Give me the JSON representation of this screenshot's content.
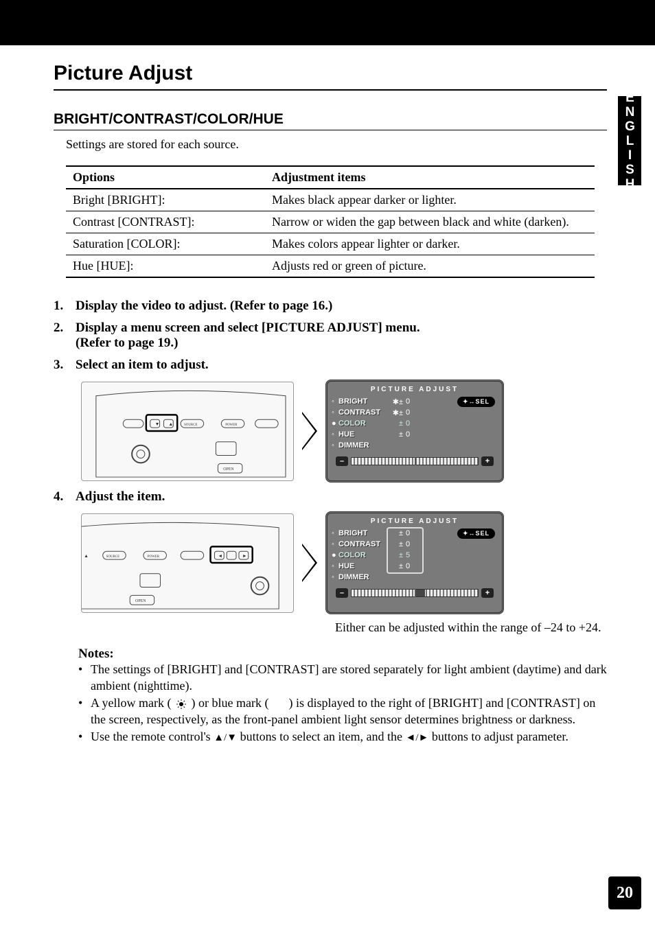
{
  "side_tab": "ENGLISH",
  "page_number": "20",
  "main_title": "Picture Adjust",
  "sub_title": "BRIGHT/CONTRAST/COLOR/HUE",
  "intro": "Settings are stored for each source.",
  "table": {
    "head_options": "Options",
    "head_adjust": "Adjustment items",
    "rows": [
      {
        "opt": "Bright [BRIGHT]:",
        "adj": "Makes black appear darker or lighter."
      },
      {
        "opt": "Contrast [CONTRAST]:",
        "adj": "Narrow or widen the gap between black and white (darken)."
      },
      {
        "opt": "Saturation [COLOR]:",
        "adj": "Makes colors appear lighter or darker."
      },
      {
        "opt": "Hue [HUE]:",
        "adj": "Adjusts red or green of picture."
      }
    ]
  },
  "steps": {
    "s1": "Display the video to adjust. (Refer to page 16.)",
    "s2a": "Display a menu screen and select [PICTURE ADJUST] menu.",
    "s2b": "(Refer to page 19.)",
    "s3": "Select an item to adjust.",
    "s4": "Adjust the item."
  },
  "osd": {
    "title": "PICTURE  ADJUST",
    "sel": "✦↔SEL",
    "items": {
      "bright": "BRIGHT",
      "contrast": "CONTRAST",
      "color": "COLOR",
      "hue": "HUE",
      "dimmer": "DIMMER"
    },
    "pm": "±",
    "star_pm": "✱±",
    "vals_a": {
      "bright": "0",
      "contrast": "0",
      "color": "0",
      "hue": "0"
    },
    "vals_b": {
      "bright": "0",
      "contrast": "0",
      "color": "5",
      "hue": "0"
    },
    "minus": "–",
    "plus": "+"
  },
  "caption": "Either can be adjusted within the range of –24 to +24.",
  "notes": {
    "title": "Notes:",
    "n1": "The settings of [BRIGHT] and [CONTRAST] are stored separately for light ambient (daytime) and dark ambient (nighttime).",
    "n2a": "A yellow mark (",
    "n2b": ") or blue mark (",
    "n2c": ") is displayed to the right of [BRIGHT] and [CONTRAST] on the screen, respectively, as the front-panel ambient light sensor determines brightness or darkness.",
    "n3a": "Use the remote control's ",
    "n3b": " buttons to select an item, and the ",
    "n3c": " buttons to adjust parameter."
  },
  "sym": {
    "updown": "▲/▼",
    "leftright": "◄/►"
  }
}
